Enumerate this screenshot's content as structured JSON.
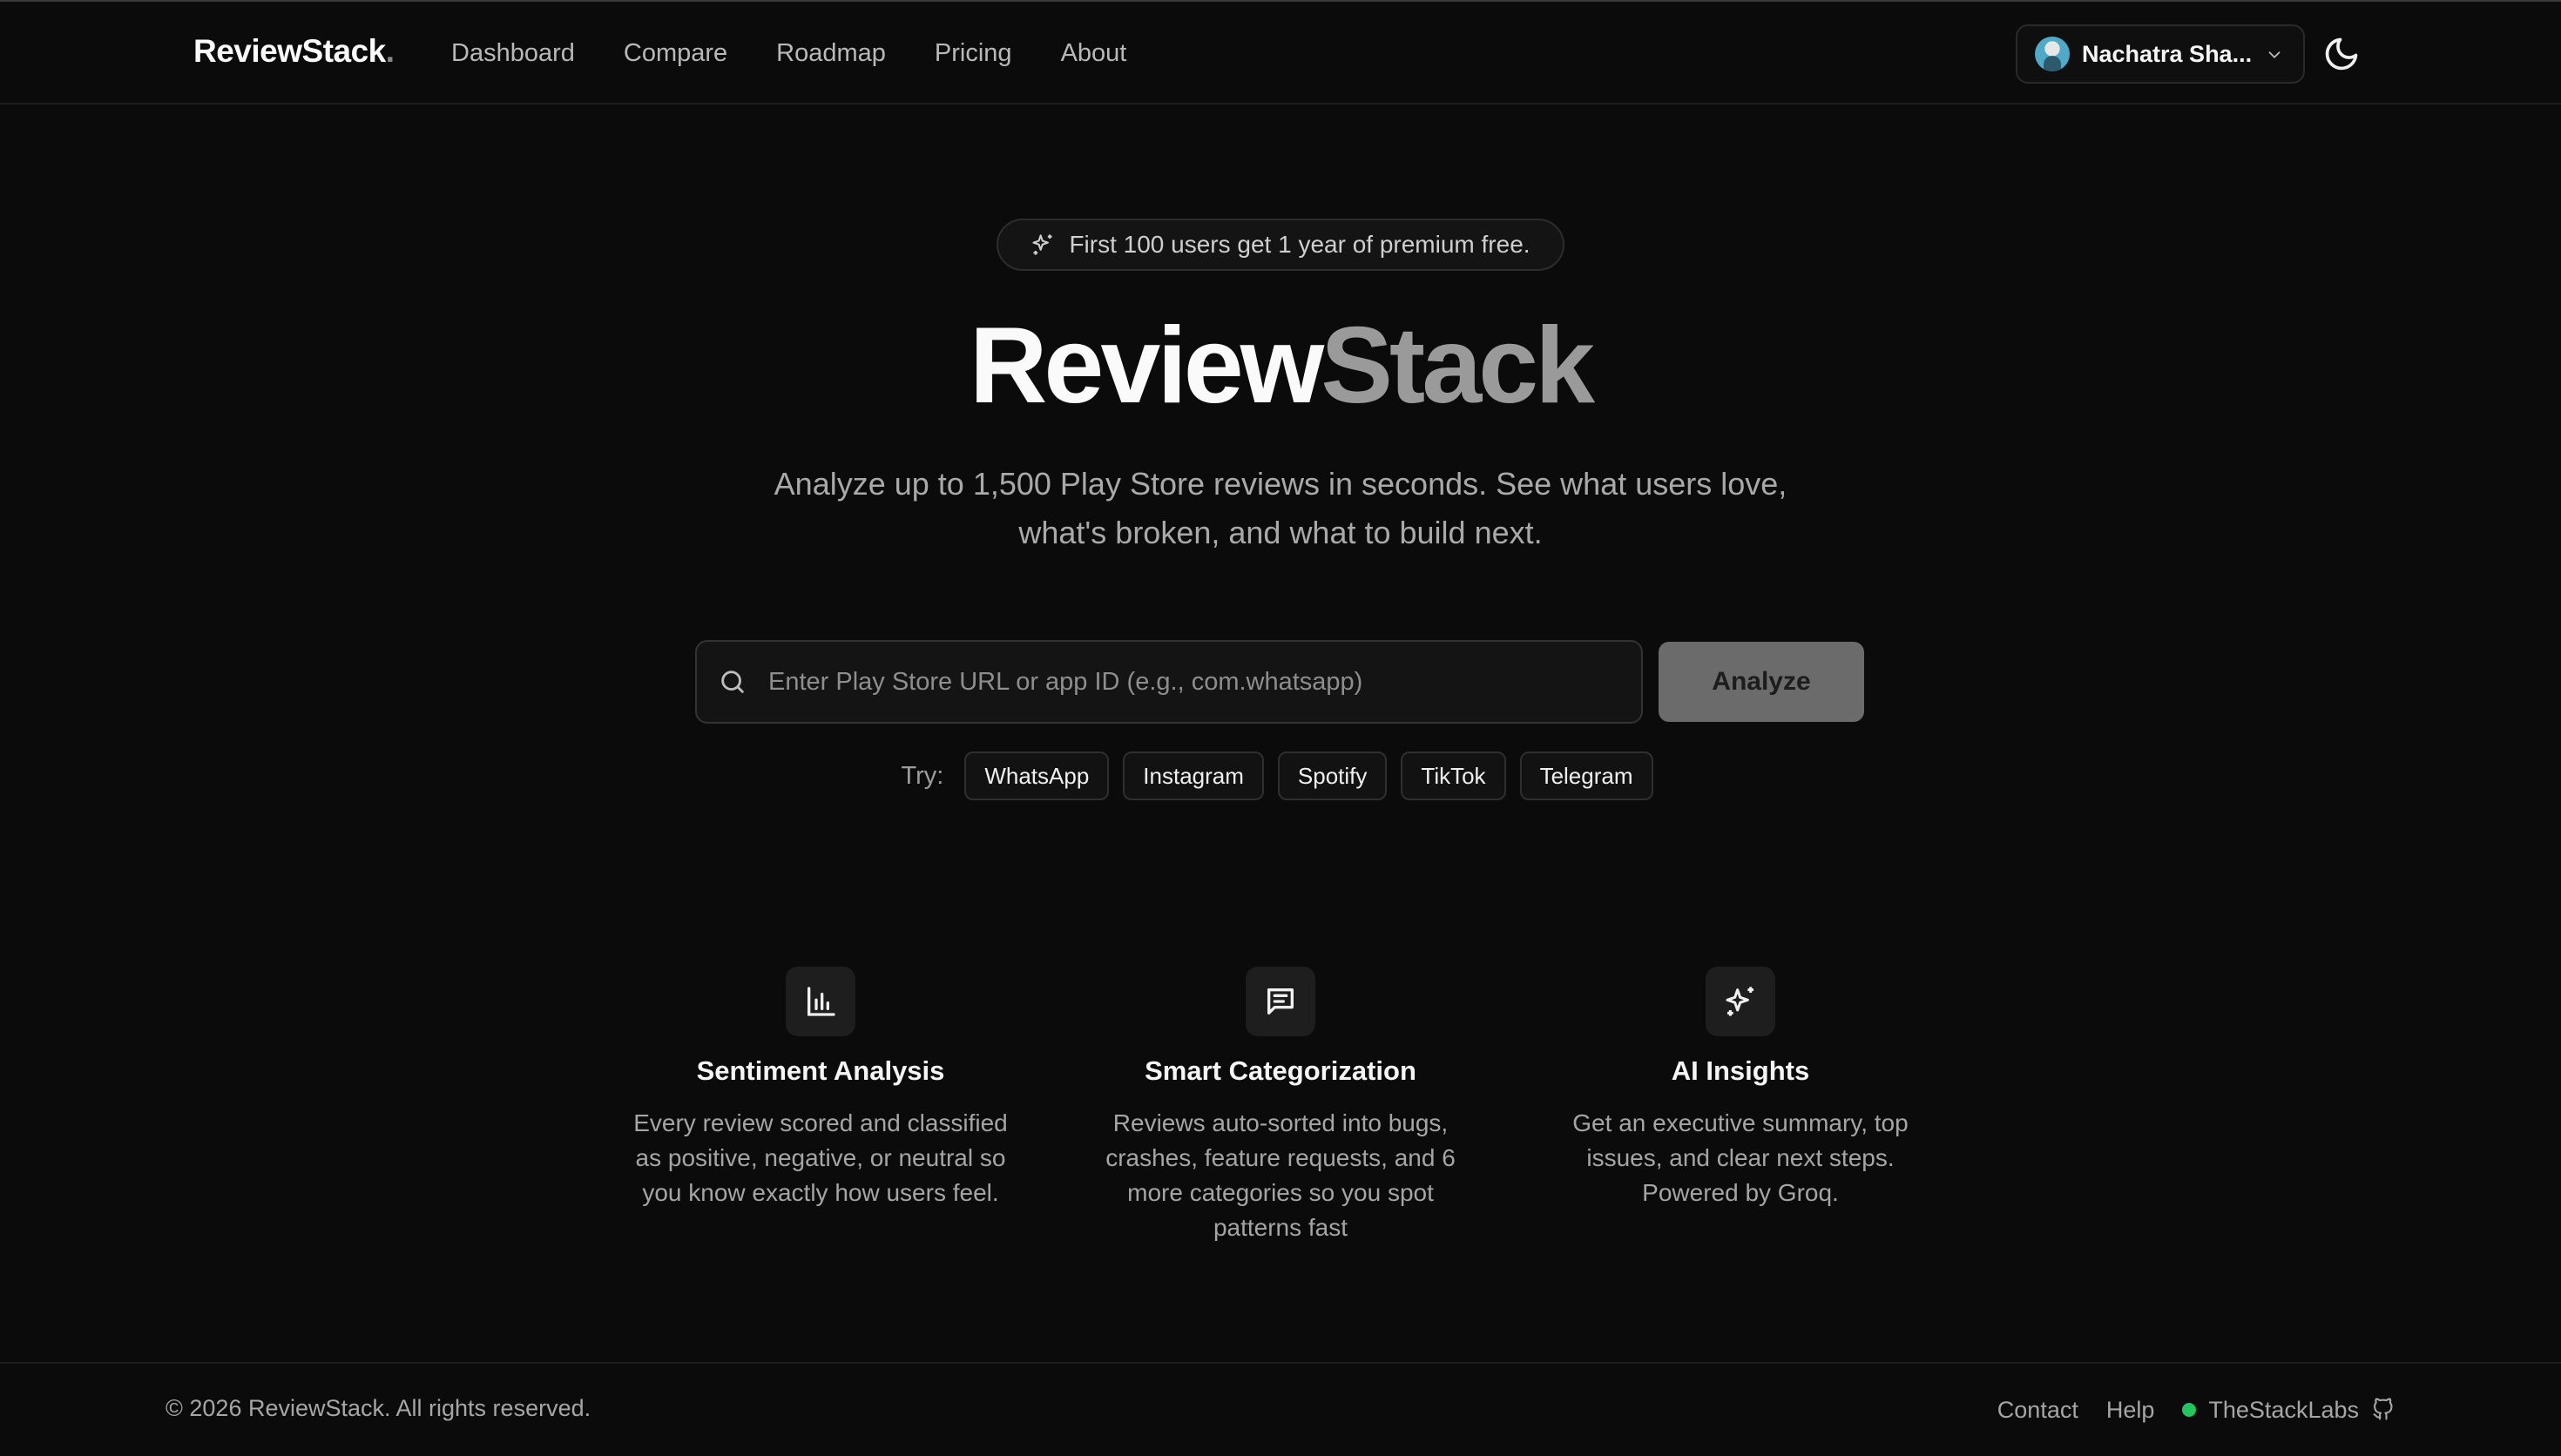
{
  "nav": {
    "brand": "ReviewStack",
    "brand_dot": ".",
    "links": [
      "Dashboard",
      "Compare",
      "Roadmap",
      "Pricing",
      "About"
    ],
    "user_name": "Nachatra Sha...",
    "user_menu_icon": "chevron-down-icon",
    "theme_icon": "moon-icon"
  },
  "hero": {
    "badge_icon": "sparkles-icon",
    "badge_text": "First 100 users get 1 year of premium free.",
    "title_part1": "Review",
    "title_part2": "Stack",
    "subtitle": "Analyze up to 1,500 Play Store reviews in seconds. See what users love, what's broken, and what to build next.",
    "search_icon": "search-icon",
    "search_placeholder": "Enter Play Store URL or app ID (e.g., com.whatsapp)",
    "search_value": "",
    "analyze_label": "Analyze",
    "try_label": "Try:",
    "try_chips": [
      "WhatsApp",
      "Instagram",
      "Spotify",
      "TikTok",
      "Telegram"
    ]
  },
  "features": [
    {
      "icon": "bar-chart-icon",
      "title": "Sentiment Analysis",
      "description": "Every review scored and classified as positive, negative, or neutral so you know exactly how users feel."
    },
    {
      "icon": "message-square-icon",
      "title": "Smart Categorization",
      "description": "Reviews auto-sorted into bugs, crashes, feature requests, and 6 more categories so you spot patterns fast"
    },
    {
      "icon": "sparkles-icon",
      "title": "AI Insights",
      "description": "Get an executive summary, top issues, and clear next steps. Powered by Groq."
    }
  ],
  "footer": {
    "copyright": "© 2026 ReviewStack. All rights reserved.",
    "links": [
      "Contact",
      "Help"
    ],
    "org": "TheStackLabs",
    "status_color": "#22c55e",
    "github_icon": "github-icon"
  },
  "colors": {
    "background": "#0b0b0b",
    "accent_muted": "#9a9a9a",
    "analyze_button": "#6b6b6b"
  }
}
